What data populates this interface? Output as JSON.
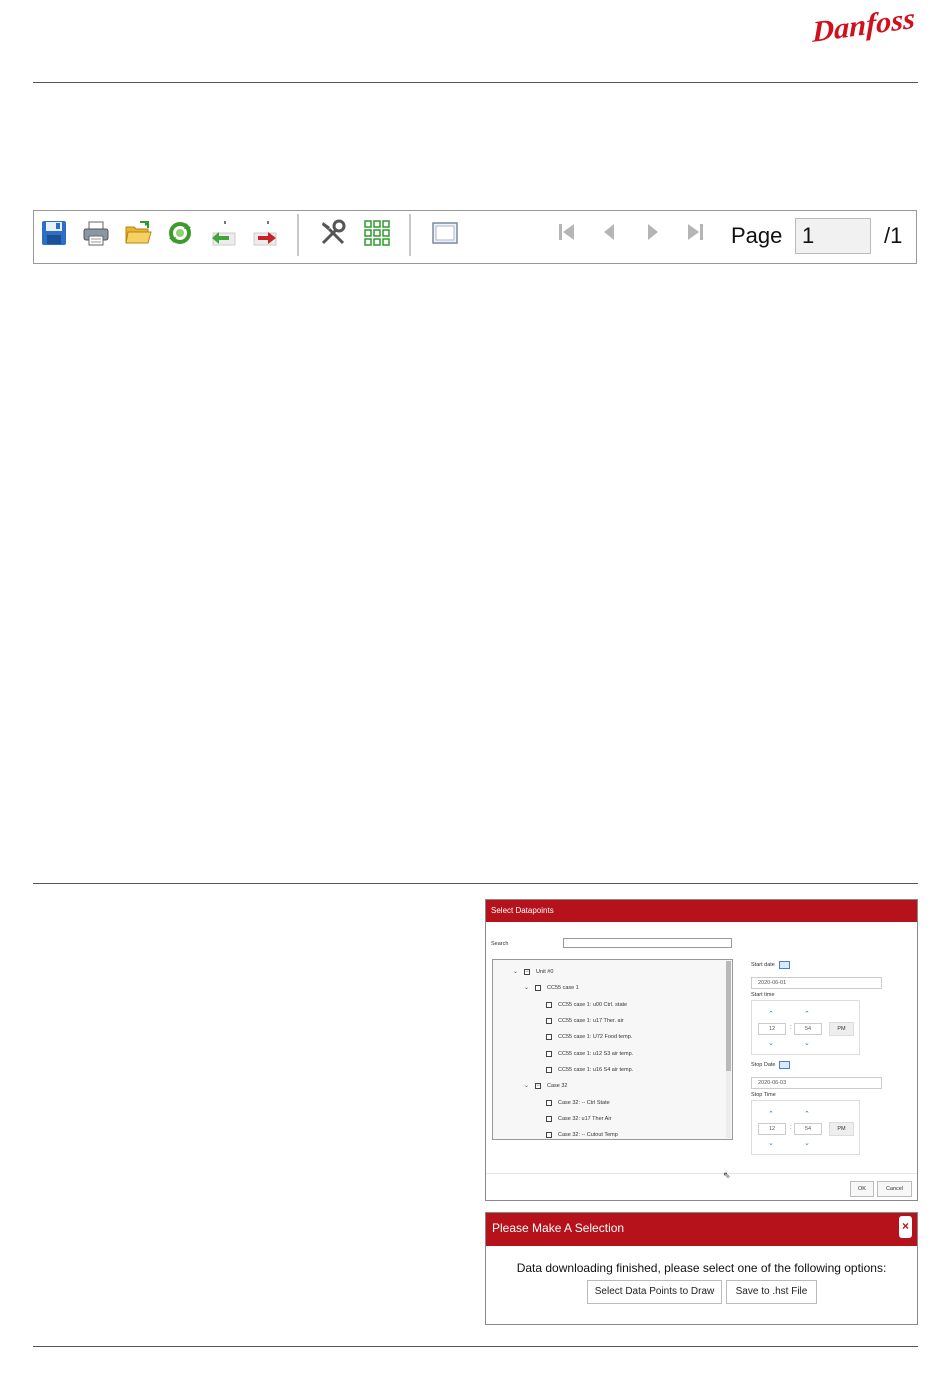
{
  "logo": {
    "text": "Danfoss",
    "color": "#d0101a"
  },
  "toolbar": {
    "buttons": [
      {
        "icon": "save-icon"
      },
      {
        "icon": "print-icon"
      },
      {
        "icon": "open-folder-icon"
      },
      {
        "icon": "refresh-icon"
      },
      {
        "icon": "import-icon"
      },
      {
        "icon": "export-icon"
      },
      {
        "icon": "tools-icon"
      },
      {
        "icon": "grid-icon"
      },
      {
        "icon": "fit-page-icon"
      }
    ],
    "nav": [
      "first-page-icon",
      "prev-page-icon",
      "next-page-icon",
      "last-page-icon"
    ],
    "page_label": "Page",
    "page_value": "1",
    "page_total": "/1"
  },
  "select_dialog": {
    "title": "Select Datapoints",
    "search_label": "Search",
    "search_value": "",
    "tree": [
      {
        "label": "Unit #0",
        "level": 0,
        "expanded": true,
        "box": "minus"
      },
      {
        "label": "CC55 case 1",
        "level": 1,
        "expanded": true,
        "box": "empty"
      },
      {
        "label": "CC55 case 1: u00 Ctrl. state",
        "level": 2
      },
      {
        "label": "CC55 case 1: u17 Ther. air",
        "level": 2
      },
      {
        "label": "CC55 case 1: U72 Food temp.",
        "level": 2
      },
      {
        "label": "CC55 case 1: u12 S3 air temp.",
        "level": 2
      },
      {
        "label": "CC55 case 1: u16 S4 air temp.",
        "level": 2
      },
      {
        "label": "Case 32",
        "level": 1,
        "expanded": true,
        "box": "minus"
      },
      {
        "label": "Case 32: -- Ctrl State",
        "level": 2
      },
      {
        "label": "Case 32: u17 Ther Air",
        "level": 2
      },
      {
        "label": "Case 32: -- Cutout Temp",
        "level": 2
      }
    ],
    "start_date_label": "Start date",
    "start_date": "2020-06-01",
    "start_time_label": "Start time",
    "start_hour": "12",
    "start_minute": "54",
    "start_ampm": "PM",
    "stop_date_label": "Stop Date",
    "stop_date": "2020-06-03",
    "stop_time_label": "Stop Time",
    "stop_hour": "12",
    "stop_minute": "54",
    "stop_ampm": "PM",
    "ok_label": "OK",
    "cancel_label": "Cancel"
  },
  "selection_dialog": {
    "title": "Please Make A Selection",
    "close_label": "×",
    "message": "Data downloading finished, please select one of the following options:",
    "btn_draw": "Select Data Points to Draw",
    "btn_save": "Save to .hst File"
  },
  "colors": {
    "accent_red": "#b5121b",
    "toolbar_border": "#999999",
    "link_blue": "#2a7ad0"
  }
}
